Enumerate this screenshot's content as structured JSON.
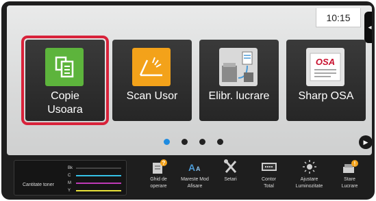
{
  "status": {
    "time": "10:15",
    "side_tab_glyph": "◂"
  },
  "tiles": [
    {
      "label": "Copie\nUsoara",
      "icon": "copy-icon",
      "accent": "#5db43c"
    },
    {
      "label": "Scan Usor",
      "icon": "scan-icon",
      "accent": "#f3a21a"
    },
    {
      "label": "Elibr. lucrare",
      "icon": "job-release-icon",
      "accent": "#4a9ad6"
    },
    {
      "label": "Sharp OSA",
      "icon": "sharp-osa-icon",
      "accent": "#c8102e"
    }
  ],
  "selection_color": "#d8223a",
  "pager": {
    "pages": 4,
    "active": 1,
    "active_color": "#1f8be0"
  },
  "toner": {
    "label": "Cantitate toner",
    "rows": [
      {
        "name": "Bk",
        "color": "#050505"
      },
      {
        "name": "C",
        "color": "#35c2e8"
      },
      {
        "name": "M",
        "color": "#c03ab8"
      },
      {
        "name": "Y",
        "color": "#e8e23a"
      }
    ]
  },
  "tools": [
    {
      "label": "Ghid de\noperare",
      "icon": "operation-guide-icon"
    },
    {
      "label": "Mareste Mod\nAfisare",
      "icon": "enlarge-display-icon"
    },
    {
      "label": "Setari",
      "icon": "settings-icon"
    },
    {
      "label": "Contor\nTotal",
      "icon": "total-count-icon"
    },
    {
      "label": "Ajustare\nLuminozitate",
      "icon": "brightness-icon"
    },
    {
      "label": "Stare\nLucrare",
      "icon": "job-status-icon"
    }
  ]
}
